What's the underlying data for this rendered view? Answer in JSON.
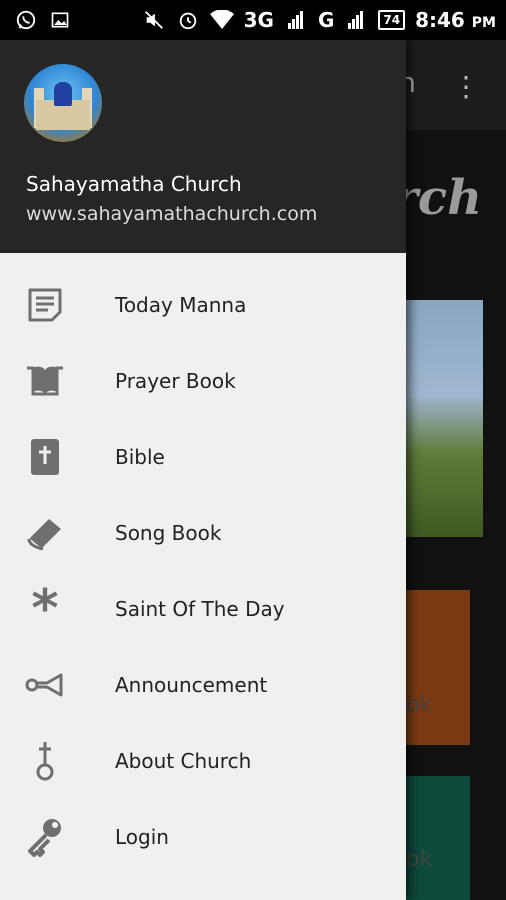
{
  "status_bar": {
    "network_3g": "3G",
    "network_g": "G",
    "battery": "74",
    "time": "8:46",
    "time_suffix": "PM"
  },
  "background_app": {
    "toolbar_title_fragment": "n",
    "hero_title_fragment": "urch",
    "card_orange_fragment": "ok",
    "card_green_fragment": "ok"
  },
  "drawer": {
    "name": "Sahayamatha Church",
    "url": "www.sahayamathachurch.com",
    "items": [
      {
        "label": "Today Manna",
        "icon": "note-icon"
      },
      {
        "label": "Prayer Book",
        "icon": "open-book-icon"
      },
      {
        "label": "Bible",
        "icon": "bible-icon"
      },
      {
        "label": "Song Book",
        "icon": "book-icon"
      },
      {
        "label": "Saint Of The Day",
        "icon": "asterisk-icon"
      },
      {
        "label": "Announcement",
        "icon": "horn-icon"
      },
      {
        "label": "About Church",
        "icon": "cross-pendant-icon"
      },
      {
        "label": "Login",
        "icon": "key-icon"
      }
    ]
  }
}
